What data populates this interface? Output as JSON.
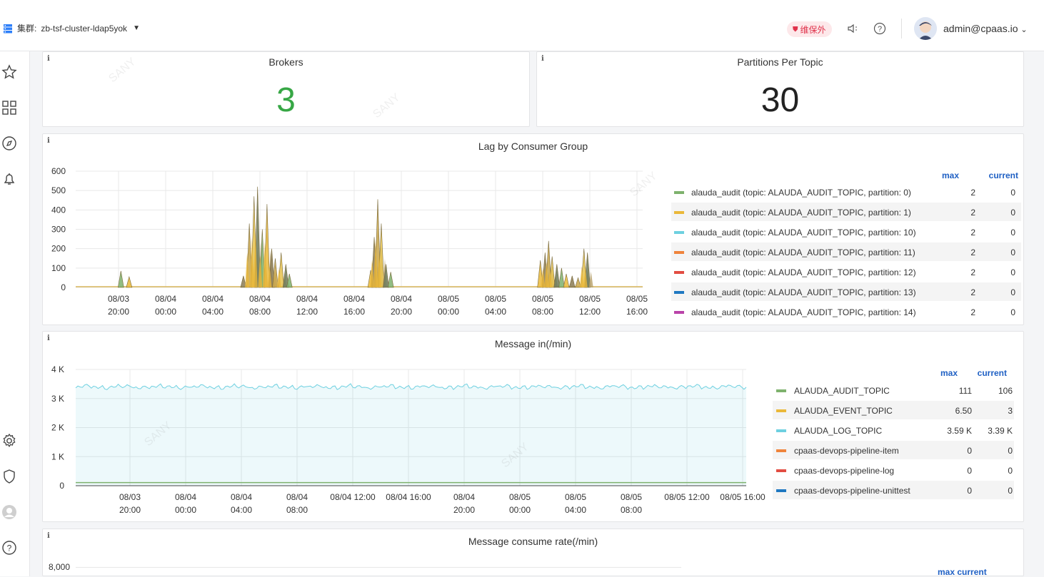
{
  "topbar": {
    "cluster_label": "集群:",
    "cluster_name": "zb-tsf-cluster-ldap5yok",
    "badge_text": "维保外",
    "user": "admin@cpaas.io"
  },
  "panels": {
    "brokers": {
      "title": "Brokers",
      "value": "3",
      "value_color": "#37a745"
    },
    "partitions": {
      "title": "Partitions Per Topic",
      "value": "30",
      "value_color": "#222222"
    },
    "lag": {
      "title": "Lag by Consumer Group",
      "legend_max_header": "max",
      "legend_current_header": "current",
      "legend": [
        {
          "name": "alauda_audit (topic: ALAUDA_AUDIT_TOPIC, partition: 0)",
          "max": "2",
          "current": "0",
          "color": "#7eb26d"
        },
        {
          "name": "alauda_audit (topic: ALAUDA_AUDIT_TOPIC, partition: 1)",
          "max": "2",
          "current": "0",
          "color": "#eab839"
        },
        {
          "name": "alauda_audit (topic: ALAUDA_AUDIT_TOPIC, partition: 10)",
          "max": "2",
          "current": "0",
          "color": "#6ed0e0"
        },
        {
          "name": "alauda_audit (topic: ALAUDA_AUDIT_TOPIC, partition: 11)",
          "max": "2",
          "current": "0",
          "color": "#ef843c"
        },
        {
          "name": "alauda_audit (topic: ALAUDA_AUDIT_TOPIC, partition: 12)",
          "max": "2",
          "current": "0",
          "color": "#e24d42"
        },
        {
          "name": "alauda_audit (topic: ALAUDA_AUDIT_TOPIC, partition: 13)",
          "max": "2",
          "current": "0",
          "color": "#1f78c1"
        },
        {
          "name": "alauda_audit (topic: ALAUDA_AUDIT_TOPIC, partition: 14)",
          "max": "2",
          "current": "0",
          "color": "#ba43a9"
        }
      ]
    },
    "msg_in": {
      "title": "Message in(/min)",
      "legend_max_header": "max",
      "legend_current_header": "current",
      "legend": [
        {
          "name": "ALAUDA_AUDIT_TOPIC",
          "max": "111",
          "current": "106",
          "color": "#7eb26d"
        },
        {
          "name": "ALAUDA_EVENT_TOPIC",
          "max": "6.50",
          "current": "3",
          "color": "#eab839"
        },
        {
          "name": "ALAUDA_LOG_TOPIC",
          "max": "3.59 K",
          "current": "3.39 K",
          "color": "#6ed0e0"
        },
        {
          "name": "cpaas-devops-pipeline-item",
          "max": "0",
          "current": "0",
          "color": "#ef843c"
        },
        {
          "name": "cpaas-devops-pipeline-log",
          "max": "0",
          "current": "0",
          "color": "#e24d42"
        },
        {
          "name": "cpaas-devops-pipeline-unittest",
          "max": "0",
          "current": "0",
          "color": "#1f78c1"
        }
      ]
    },
    "consume": {
      "title": "Message consume rate(/min)",
      "legend_header": "max  current"
    }
  },
  "chart_data": [
    {
      "type": "area",
      "title": "Lag by Consumer Group",
      "ylim": [
        0,
        600
      ],
      "y_ticks": [
        "600",
        "500",
        "400",
        "300",
        "200",
        "100",
        "0"
      ],
      "x_ticks": [
        [
          "08/03",
          "20:00"
        ],
        [
          "08/04",
          "00:00"
        ],
        [
          "08/04",
          "04:00"
        ],
        [
          "08/04",
          "08:00"
        ],
        [
          "08/04",
          "12:00"
        ],
        [
          "08/04",
          "16:00"
        ],
        [
          "08/04",
          "20:00"
        ],
        [
          "08/05",
          "00:00"
        ],
        [
          "08/05",
          "04:00"
        ],
        [
          "08/05",
          "08:00"
        ],
        [
          "08/05",
          "12:00"
        ],
        [
          "08/05",
          "16:00"
        ]
      ],
      "spikes_hours_from_0803_20": [
        [
          0.2,
          85
        ],
        [
          0.9,
          55
        ],
        [
          10.6,
          60
        ],
        [
          11.1,
          330
        ],
        [
          11.5,
          470
        ],
        [
          11.8,
          520
        ],
        [
          12.2,
          300
        ],
        [
          12.6,
          430
        ],
        [
          13.0,
          200
        ],
        [
          13.3,
          150
        ],
        [
          13.8,
          180
        ],
        [
          14.2,
          120
        ],
        [
          14.5,
          70
        ],
        [
          21.4,
          90
        ],
        [
          21.7,
          260
        ],
        [
          22.0,
          455
        ],
        [
          22.3,
          330
        ],
        [
          22.7,
          120
        ],
        [
          23.1,
          80
        ],
        [
          35.8,
          140
        ],
        [
          36.2,
          180
        ],
        [
          36.5,
          240
        ],
        [
          36.8,
          160
        ],
        [
          37.2,
          120
        ],
        [
          37.6,
          100
        ],
        [
          38.0,
          70
        ],
        [
          38.5,
          60
        ],
        [
          39.0,
          50
        ],
        [
          39.5,
          200
        ],
        [
          39.8,
          180
        ]
      ]
    },
    {
      "type": "line",
      "title": "Message in(/min)",
      "ylim": [
        0,
        4000
      ],
      "y_ticks": [
        "4 K",
        "3 K",
        "2 K",
        "1 K",
        "0"
      ],
      "x_ticks": [
        [
          "08/03",
          "20:00"
        ],
        [
          "08/04",
          "00:00"
        ],
        [
          "08/04",
          "04:00"
        ],
        [
          "08/04",
          "08:00"
        ],
        [
          "08/04 12:00",
          ""
        ],
        [
          "08/04 16:00",
          ""
        ],
        [
          "08/04",
          "20:00"
        ],
        [
          "08/05",
          "00:00"
        ],
        [
          "08/05",
          "04:00"
        ],
        [
          "08/05",
          "08:00"
        ],
        [
          "08/05 12:00",
          ""
        ],
        [
          "08/05 16:00",
          ""
        ]
      ],
      "series": [
        {
          "name": "ALAUDA_LOG_TOPIC",
          "level": 3400,
          "color": "#6ed0e0"
        },
        {
          "name": "ALAUDA_AUDIT_TOPIC",
          "level": 106,
          "color": "#7eb26d"
        }
      ]
    }
  ],
  "consume_chart": {
    "y_top": "8,000"
  }
}
